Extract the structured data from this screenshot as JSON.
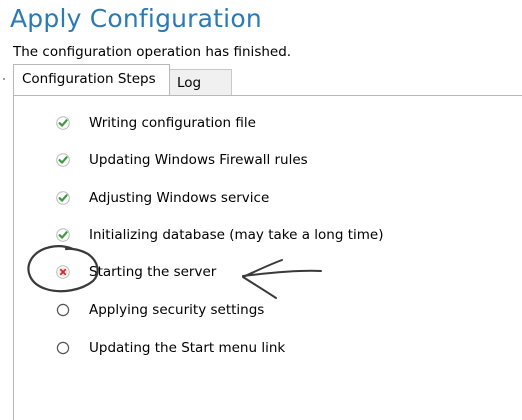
{
  "title": "Apply Configuration",
  "status_message": "The configuration operation has finished.",
  "tabs": [
    {
      "label": "Configuration Steps",
      "active": true
    },
    {
      "label": "Log",
      "active": false
    }
  ],
  "steps": [
    {
      "label": "Writing configuration file",
      "status": "completed",
      "icon": "check-icon"
    },
    {
      "label": "Updating Windows Firewall rules",
      "status": "completed",
      "icon": "check-icon"
    },
    {
      "label": "Adjusting Windows service",
      "status": "completed",
      "icon": "check-icon"
    },
    {
      "label": "Initializing database (may take a long time)",
      "status": "completed",
      "icon": "check-icon"
    },
    {
      "label": "Starting the server",
      "status": "failed",
      "icon": "error-icon"
    },
    {
      "label": "Applying security settings",
      "status": "pending",
      "icon": "pending-circle-icon"
    },
    {
      "label": "Updating the Start menu link",
      "status": "pending",
      "icon": "pending-circle-icon"
    }
  ],
  "colors": {
    "title": "#2a7ab6",
    "completed": "#3d9a3d",
    "failed": "#d32b2b",
    "pending": "#555555",
    "annotation_ink": "#3a3a3a"
  }
}
